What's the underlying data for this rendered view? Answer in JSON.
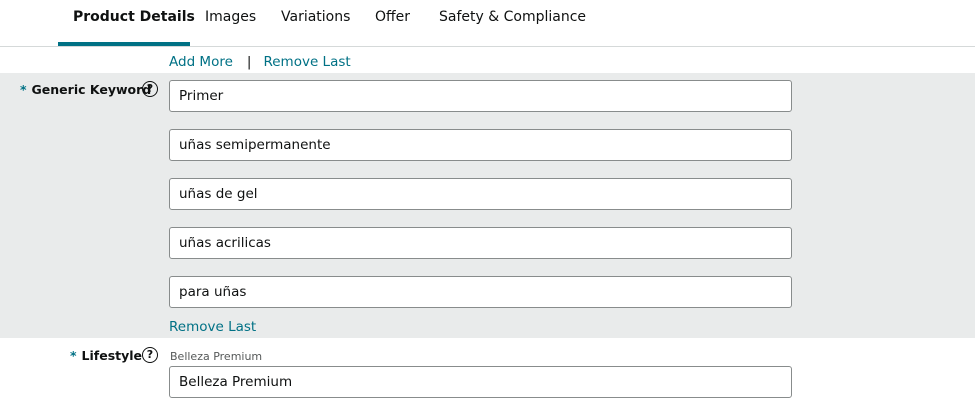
{
  "tabs": [
    {
      "label": "Product Details",
      "active": true
    },
    {
      "label": "Images"
    },
    {
      "label": "Variations"
    },
    {
      "label": "Offer"
    },
    {
      "label": "Safety & Compliance"
    }
  ],
  "keywords_controls": {
    "add_more": "Add More",
    "separator": "|",
    "remove_last_top": "Remove Last",
    "remove_last_bottom": "Remove Last"
  },
  "generic_keyword": {
    "required_mark": "*",
    "label": "Generic Keyword",
    "help_icon": "?",
    "values": [
      "Primer",
      "uñas semipermanente",
      "uñas de gel",
      "uñas acrilicas",
      "para uñas"
    ]
  },
  "lifestyle": {
    "required_mark": "*",
    "label": "Lifestyle",
    "help_icon": "?",
    "caption": "Belleza Premium",
    "value": "Belleza Premium"
  },
  "colors": {
    "accent": "#007185",
    "section_bg": "#e9ebeb",
    "field_border": "#888c8c"
  }
}
